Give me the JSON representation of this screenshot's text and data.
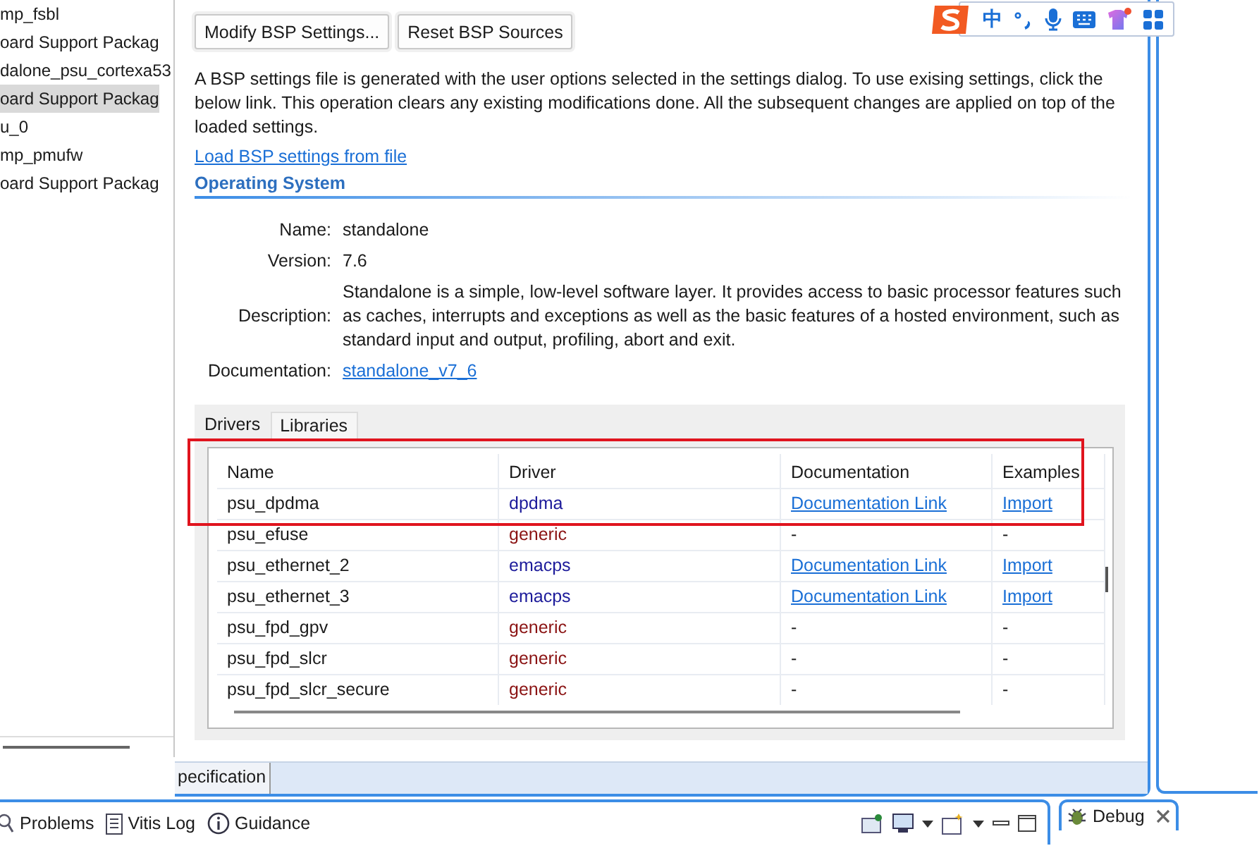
{
  "project_tree": {
    "items": [
      {
        "label": "mp_fsbl",
        "selected": false
      },
      {
        "label": "oard Support Packag",
        "selected": false
      },
      {
        "label": "dalone_psu_cortexa53",
        "selected": false
      },
      {
        "label": "oard Support Packag",
        "selected": true
      },
      {
        "label": "u_0",
        "selected": false
      },
      {
        "label": "mp_pmufw",
        "selected": false
      },
      {
        "label": "oard Support Packag",
        "selected": false
      }
    ]
  },
  "bsp_editor": {
    "buttons": [
      "Modify BSP Settings...",
      "Reset BSP Sources"
    ],
    "intro": "A BSP settings file is generated with the user options selected in the settings dialog. To use exising settings, click the below link. This operation clears any existing modifications done. All the subsequent changes are applied on top of the loaded settings.",
    "load_link": "Load BSP settings from file",
    "section_title": "Operating System",
    "fields": [
      {
        "label": "Name:",
        "value": "standalone",
        "kind": "text"
      },
      {
        "label": "Version:",
        "value": "7.6",
        "kind": "text"
      },
      {
        "label": "Description:",
        "value": "Standalone is a simple, low-level software layer. It provides access to basic processor features such as caches, interrupts and exceptions as well as the basic features of a hosted environment, such as standard input and output, profiling, abort and exit.",
        "kind": "text"
      },
      {
        "label": "Documentation:",
        "value": "standalone_v7_6",
        "kind": "link"
      }
    ],
    "tabs": [
      {
        "label": "Drivers",
        "selected": true
      },
      {
        "label": "Libraries",
        "selected": false
      }
    ],
    "table": {
      "columns": [
        "Name",
        "Driver",
        "Documentation",
        "Examples"
      ],
      "rows": [
        {
          "name": "psu_dpdma",
          "driver": "dpdma",
          "color": "#1c1a9a",
          "documentation": "Documentation Link",
          "examples": "Import"
        },
        {
          "name": "psu_efuse",
          "driver": "generic",
          "color": "#8a1212",
          "documentation": "-",
          "examples": "-"
        },
        {
          "name": "psu_ethernet_2",
          "driver": "emacps",
          "color": "#1c1a9a",
          "documentation": "Documentation Link",
          "examples": "Import"
        },
        {
          "name": "psu_ethernet_3",
          "driver": "emacps",
          "color": "#1c1a9a",
          "documentation": "Documentation Link",
          "examples": "Import"
        },
        {
          "name": "psu_fpd_gpv",
          "driver": "generic",
          "color": "#8a1212",
          "documentation": "-",
          "examples": "-"
        },
        {
          "name": "psu_fpd_slcr",
          "driver": "generic",
          "color": "#8a1212",
          "documentation": "-",
          "examples": "-"
        },
        {
          "name": "psu_fpd_slcr_secure",
          "driver": "generic",
          "color": "#8a1212",
          "documentation": "-",
          "examples": "-"
        }
      ]
    }
  },
  "editor_tabs": [
    {
      "label": "pecification",
      "selected": true
    }
  ],
  "bottom_panel": {
    "tabs": [
      {
        "label": "Problems"
      },
      {
        "label": "Vitis Log"
      },
      {
        "label": "Guidance"
      }
    ]
  },
  "debug_panel": {
    "tab": "Debug"
  },
  "ime_toolbar": {
    "mode": "中"
  }
}
